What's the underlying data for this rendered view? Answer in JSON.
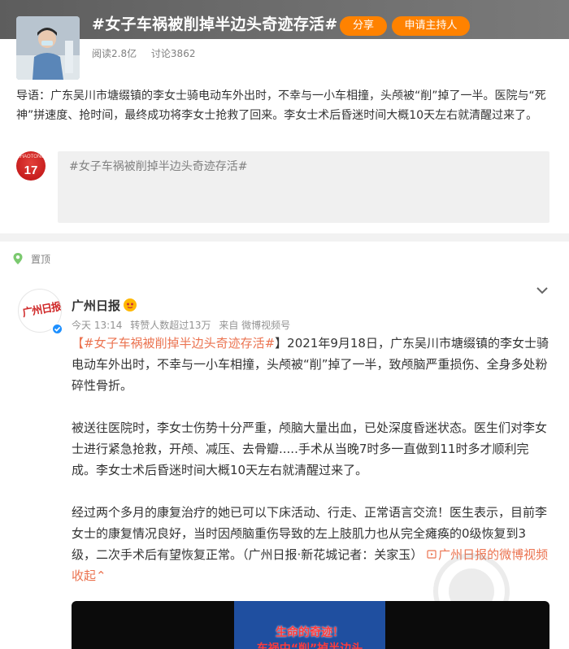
{
  "topic": {
    "title": "#女子车祸被削掉半边头奇迹存活#",
    "share_label": "分享",
    "host_label": "申请主持人",
    "reads": "阅读2.8亿",
    "discussions": "讨论3862",
    "lead": "导语：广东吴川市塘缀镇的李女士骑电动车外出时，不幸与一小车相撞，头颅被“削”掉了一半。医院与“死神”拼速度、抢时间，最终成功将李女士抢救了回来。李女士术后昏迷时间大概10天左右就清醒过来了。",
    "avatar_number": "17",
    "avatar_small": "ZHAOTONG",
    "compose_placeholder": "#女子车祸被削掉半边头奇迹存活#"
  },
  "post": {
    "pinned_label": "置顶",
    "author": "广州日报",
    "avatar_text": "广州日报",
    "time": "今天 13:14",
    "reposts": "转赞人数超过13万",
    "source": "来自 微博视频号",
    "hashtag": "#女子车祸被削掉半边头奇迹存活#",
    "para1": "】2021年9月18日，广东吴川市塘缀镇的李女士骑电动车外出时，不幸与一小车相撞，头颅被“削”掉了一半，致颅脑严重损伤、全身多处粉碎性骨折。",
    "para2": "被送往医院时，李女士伤势十分严重，颅脑大量出血，已处深度昏迷状态。医生们对李女士进行紧急抢救，开颅、减压、去骨瓣.....手术从当晚7时多一直做到11时多才顺利完成。李女士术后昏迷时间大概10天左右就清醒过来了。",
    "para3": "经过两个多月的康复治疗的她已可以下床活动、行走、正常语言交流！医生表示，目前李女士的康复情况良好，当时因颅脑重伤导致的左上肢肌力也从完全瘫痪的0级恢复到3级，二次手术后有望恢复正常。（广州日报·新花城记者：关家玉）",
    "video_link": "广州日报的微博视频",
    "collapse": "收起",
    "video_text1": "生命的奇迹！",
    "video_text2": "车祸中“削”掉半边头"
  }
}
